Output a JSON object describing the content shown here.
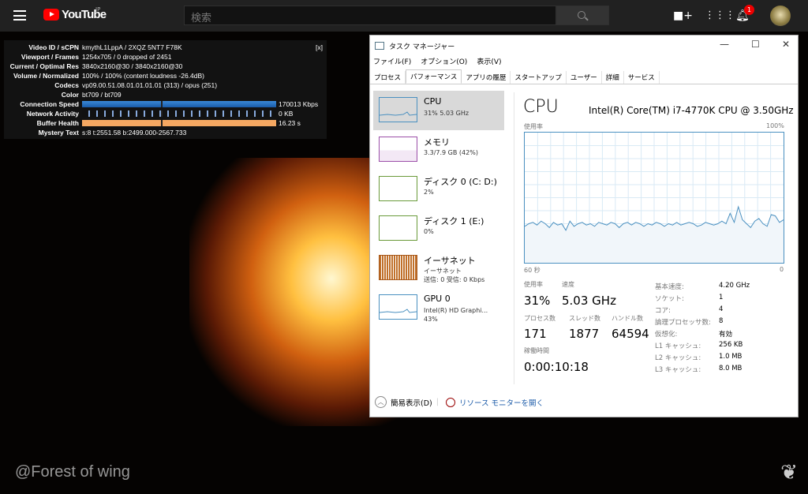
{
  "youtube": {
    "brand": "YouTube",
    "region": "JP",
    "search_placeholder": "検索",
    "notification_count": "1",
    "icons": [
      "menu-icon",
      "create-video-icon",
      "apps-icon",
      "bell-icon",
      "avatar"
    ]
  },
  "stats": {
    "close": "[x]",
    "rows": [
      {
        "label": "Video ID / sCPN",
        "value": "kmythL1LppA / 2XQZ 5NT7 F78K"
      },
      {
        "label": "Viewport / Frames",
        "value": "1254x705 / 0 dropped of 2451"
      },
      {
        "label": "Current / Optimal Res",
        "value": "3840x2160@30 / 3840x2160@30"
      },
      {
        "label": "Volume / Normalized",
        "value": "100% / 100% (content loudness -26.4dB)"
      },
      {
        "label": "Codecs",
        "value": "vp09.00.51.08.01.01.01.01 (313) / opus (251)"
      },
      {
        "label": "Color",
        "value": "bt709 / bt709"
      }
    ],
    "bars": [
      {
        "label": "Connection Speed",
        "value": "170013 Kbps",
        "kind": "conn"
      },
      {
        "label": "Network Activity",
        "value": "0 KB",
        "kind": "net"
      },
      {
        "label": "Buffer Health",
        "value": "16.23 s",
        "kind": "buf"
      }
    ],
    "mystery": {
      "label": "Mystery Text",
      "value": "s:8 t:2551.58 b:2499.000-2567.733"
    }
  },
  "watermark": "@Forest of wing",
  "taskmanager": {
    "title": "タスク マネージャー",
    "menu": [
      "ファイル(F)",
      "オプション(O)",
      "表示(V)"
    ],
    "tabs": [
      "プロセス",
      "パフォーマンス",
      "アプリの履歴",
      "スタートアップ",
      "ユーザー",
      "詳細",
      "サービス"
    ],
    "active_tab": "パフォーマンス",
    "side": [
      {
        "name": "CPU",
        "sub": "31%  5.03 GHz",
        "color": "#4a90c0"
      },
      {
        "name": "メモリ",
        "sub": "3.3/7.9 GB (42%)",
        "color": "#9b4fa8"
      },
      {
        "name": "ディスク 0 (C: D:)",
        "sub": "2%",
        "color": "#6a9a3a"
      },
      {
        "name": "ディスク 1 (E:)",
        "sub": "0%",
        "color": "#6a9a3a"
      },
      {
        "name": "イーサネット",
        "sub": "イーサネット",
        "sub2": "送信: 0 受信: 0 Kbps",
        "color": "#a8581a"
      },
      {
        "name": "GPU 0",
        "sub": "Intel(R) HD Graphi...",
        "sub2": "43%",
        "color": "#4a90c0"
      }
    ],
    "main": {
      "heading": "CPU",
      "model": "Intel(R) Core(TM) i7-4770K CPU @ 3.50GHz",
      "graph_label": "使用率",
      "graph_max": "100%",
      "graph_left": "60 秒",
      "graph_right": "0",
      "usage_label": "使用率",
      "usage": "31%",
      "speed_label": "速度",
      "speed": "5.03 GHz",
      "proc_label": "プロセス数",
      "proc": "171",
      "thread_label": "スレッド数",
      "thread": "1877",
      "handle_label": "ハンドル数",
      "handle": "64594",
      "uptime_label": "稼働時間",
      "uptime": "0:00:10:18",
      "specs": [
        {
          "k": "基本速度:",
          "v": "4.20 GHz"
        },
        {
          "k": "ソケット:",
          "v": "1"
        },
        {
          "k": "コア:",
          "v": "4"
        },
        {
          "k": "論理プロセッサ数:",
          "v": "8"
        },
        {
          "k": "仮想化:",
          "v": "有効"
        },
        {
          "k": "L1 キャッシュ:",
          "v": "256 KB"
        },
        {
          "k": "L2 キャッシュ:",
          "v": "1.0 MB"
        },
        {
          "k": "L3 キャッシュ:",
          "v": "8.0 MB"
        }
      ]
    },
    "footer": {
      "simple": "簡易表示(D)",
      "resmon": "リソース モニターを開く"
    }
  },
  "chart_data": {
    "type": "area",
    "ylim": [
      0,
      100
    ],
    "xlabel": "60 秒",
    "ylabel": "使用率",
    "grid": true,
    "values": [
      28,
      30,
      31,
      29,
      32,
      30,
      27,
      31,
      29,
      30,
      25,
      32,
      28,
      30,
      31,
      29,
      30,
      28,
      31,
      30,
      29,
      31,
      30,
      27,
      30,
      31,
      29,
      31,
      30,
      28,
      30,
      29,
      31,
      30,
      28,
      30,
      29,
      31,
      29,
      30,
      31,
      30,
      28,
      29,
      31,
      30,
      29,
      30,
      32,
      30,
      38,
      31,
      43,
      33,
      30,
      27,
      32,
      34,
      30,
      28,
      37,
      36,
      31,
      33
    ]
  }
}
